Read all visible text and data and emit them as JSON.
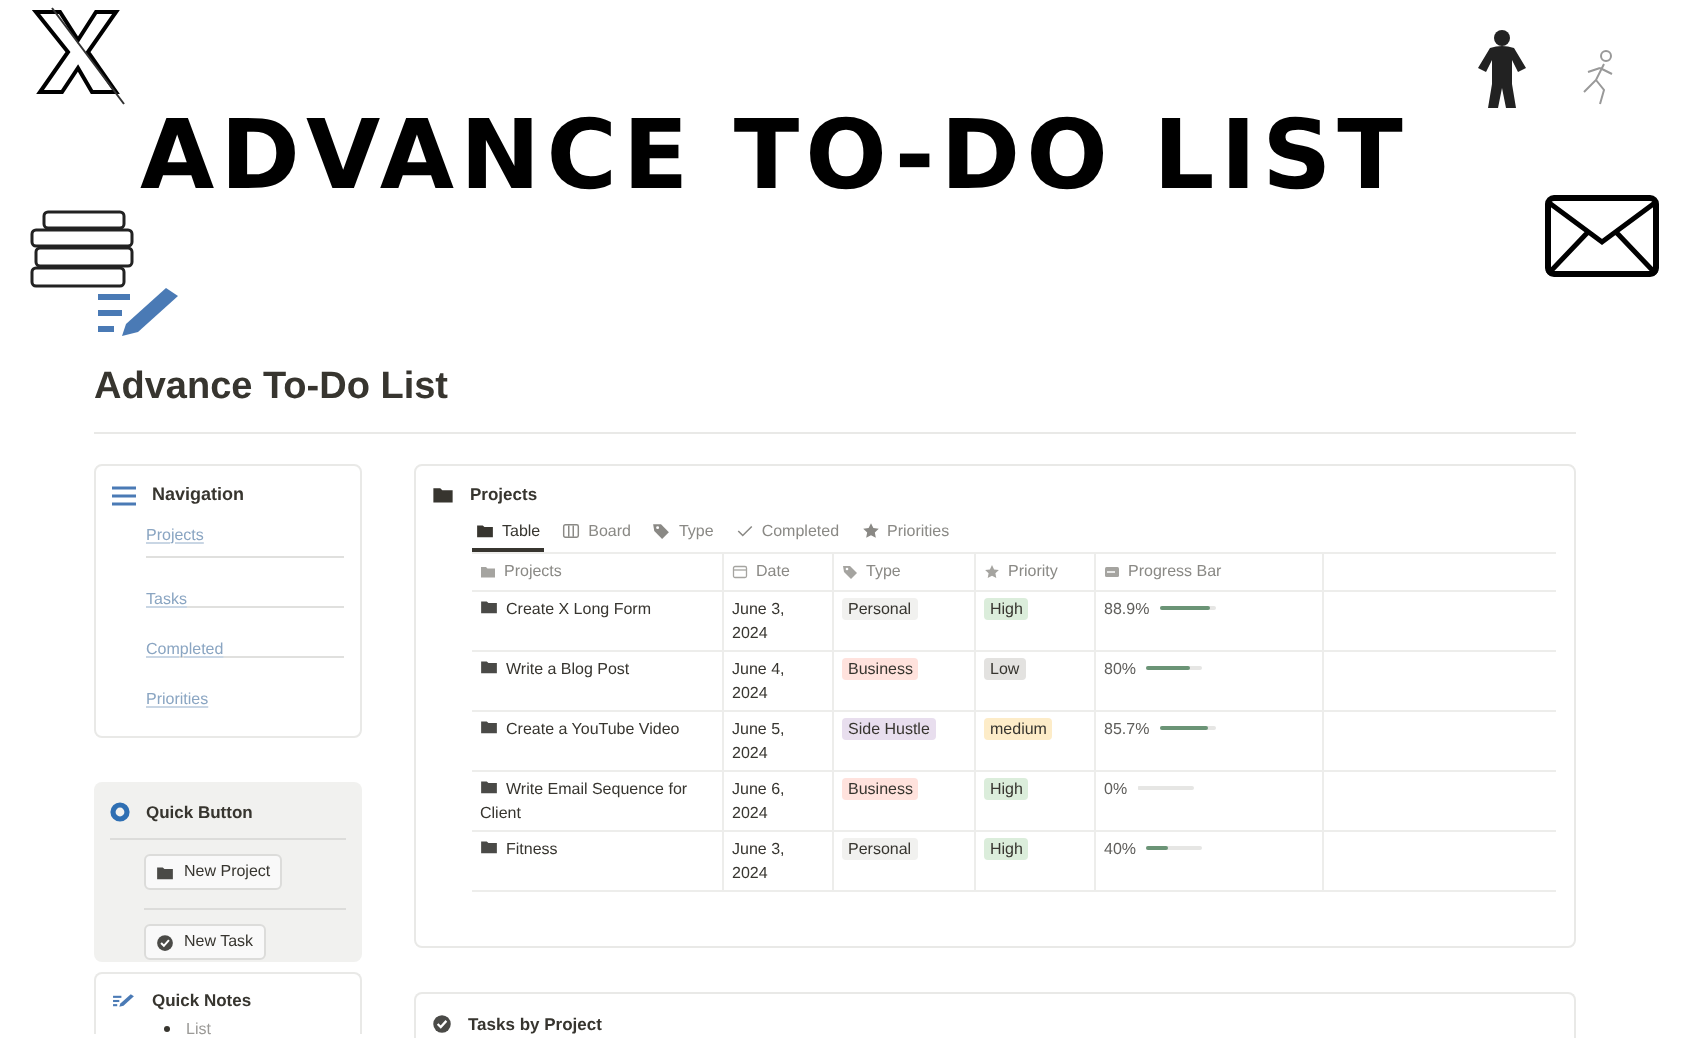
{
  "cover": {
    "title": "ADVANCE TO-DO LIST"
  },
  "page": {
    "title": "Advance To-Do List"
  },
  "navigation": {
    "title": "Navigation",
    "links": [
      "Projects",
      "Tasks",
      "Completed",
      "Priorities"
    ]
  },
  "quick_button": {
    "title": "Quick Button",
    "buttons": [
      {
        "label": "New Project",
        "kind": "folder"
      },
      {
        "label": "New Task",
        "kind": "check"
      }
    ]
  },
  "quick_notes": {
    "title": "Quick Notes",
    "items": [
      "List"
    ]
  },
  "projects": {
    "title": "Projects",
    "views": [
      {
        "label": "Table",
        "kind": "table",
        "selected": true
      },
      {
        "label": "Board",
        "kind": "board",
        "selected": false
      },
      {
        "label": "Type",
        "kind": "tag",
        "selected": false
      },
      {
        "label": "Completed",
        "kind": "check",
        "selected": false
      },
      {
        "label": "Priorities",
        "kind": "star",
        "selected": false
      }
    ],
    "columns": [
      {
        "label": "Projects",
        "kind": "folder"
      },
      {
        "label": "Date",
        "kind": "calendar"
      },
      {
        "label": "Type",
        "kind": "tag"
      },
      {
        "label": "Priority",
        "kind": "star"
      },
      {
        "label": "Progress Bar",
        "kind": "bar"
      }
    ],
    "rows": [
      {
        "name": "Create X Long Form",
        "date": "June 3, 2024",
        "type": {
          "label": "Personal",
          "color": "#f1f1ef"
        },
        "priority": {
          "label": "High",
          "color": "#dbeddb"
        },
        "progress": "88.9%",
        "level": 0.889
      },
      {
        "name": "Write a Blog Post",
        "date": "June 4, 2024",
        "type": {
          "label": "Business",
          "color": "#ffe2dd"
        },
        "priority": {
          "label": "Low",
          "color": "#e3e2e0"
        },
        "progress": "80%",
        "level": 0.8
      },
      {
        "name": "Create a YouTube Video",
        "date": "June 5, 2024",
        "type": {
          "label": "Side Hustle",
          "color": "#e8deee"
        },
        "priority": {
          "label": "medium",
          "color": "#fdecc8"
        },
        "progress": "85.7%",
        "level": 0.857
      },
      {
        "name": "Write Email Sequence for Client",
        "date": "June 6, 2024",
        "type": {
          "label": "Business",
          "color": "#ffe2dd"
        },
        "priority": {
          "label": "High",
          "color": "#dbeddb"
        },
        "progress": "0%",
        "level": 0
      },
      {
        "name": "Fitness",
        "date": "June 3, 2024",
        "type": {
          "label": "Personal",
          "color": "#f1f1ef"
        },
        "priority": {
          "label": "High",
          "color": "#dbeddb"
        },
        "progress": "40%",
        "level": 0.4
      }
    ]
  },
  "tasks_by_project": {
    "title": "Tasks by Project"
  }
}
